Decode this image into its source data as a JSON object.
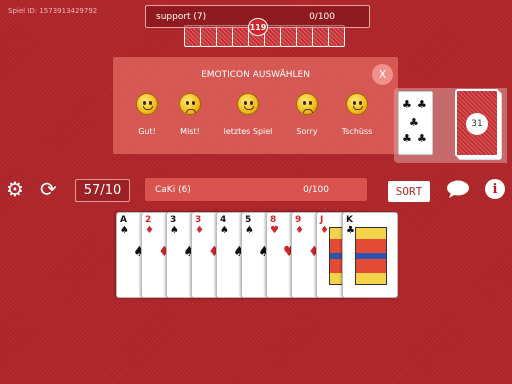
{
  "game_id": "Spiel ID: 1573913429792",
  "opponent": {
    "name": "support (7)",
    "score": "0/100",
    "badge": "119"
  },
  "emoticon_panel": {
    "title": "EMOTICON AUSWÄHLEN",
    "close_label": "X",
    "items": [
      {
        "label": "Gut!",
        "icon": "happy-emoticon-icon"
      },
      {
        "label": "Mist!",
        "icon": "sad-emoticon-icon"
      },
      {
        "label": "letztes Spiel",
        "icon": "last-game-emoticon-icon"
      },
      {
        "label": "Sorry",
        "icon": "sorry-emoticon-icon"
      },
      {
        "label": "Tschüss",
        "icon": "goodbye-emoticon-icon"
      }
    ]
  },
  "deck": {
    "count": "31"
  },
  "controls": {
    "score": "57/10",
    "sort_label": "SORT"
  },
  "player": {
    "name": "CaKi (6)",
    "score": "0/100"
  },
  "hand": [
    {
      "rank": "A",
      "suit": "♠",
      "color": "black"
    },
    {
      "rank": "2",
      "suit": "♦",
      "color": "red"
    },
    {
      "rank": "3",
      "suit": "♠",
      "color": "black"
    },
    {
      "rank": "3",
      "suit": "♦",
      "color": "red"
    },
    {
      "rank": "4",
      "suit": "♠",
      "color": "black"
    },
    {
      "rank": "5",
      "suit": "♠",
      "color": "black"
    },
    {
      "rank": "8",
      "suit": "♥",
      "color": "red"
    },
    {
      "rank": "9",
      "suit": "♦",
      "color": "red"
    },
    {
      "rank": "J",
      "suit": "♦",
      "color": "red"
    },
    {
      "rank": "K",
      "suit": "♣",
      "color": "black"
    }
  ],
  "colors": {
    "table": "#b0262a",
    "accent": "#d9534f"
  }
}
